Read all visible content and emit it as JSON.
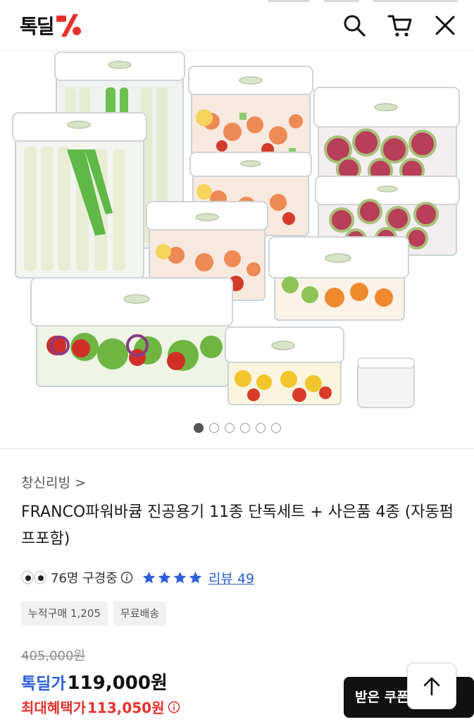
{
  "header": {
    "logo_text": "톡딜",
    "logo_mark_icon": "percent-mark-icon",
    "icons": [
      "search-icon",
      "cart-icon",
      "close-icon"
    ]
  },
  "gallery": {
    "image_count": 6,
    "active_index": 0
  },
  "product": {
    "seller": "창신리빙 >",
    "title": "FRANCO파워바큠 진공용기 11종 단독세트 + 사은품 4종 (자동펌프포함)",
    "watching": "76명 구경중",
    "rating_stars": 4,
    "review_link": "리뷰 49",
    "tags": [
      "누적구매 1,205",
      "무료배송"
    ]
  },
  "price": {
    "original": "405,000원",
    "deal_label": "톡딜가",
    "deal_value": "119,000원",
    "max_label": "최대혜택가",
    "max_value": "113,050원"
  },
  "actions": {
    "coupon_button": "받은 쿠폰",
    "scroll_top_icon": "arrow-up-icon"
  },
  "colors": {
    "accent_blue": "#2b5fd9",
    "accent_red": "#e5322d",
    "logo_red": "#e5322d"
  }
}
